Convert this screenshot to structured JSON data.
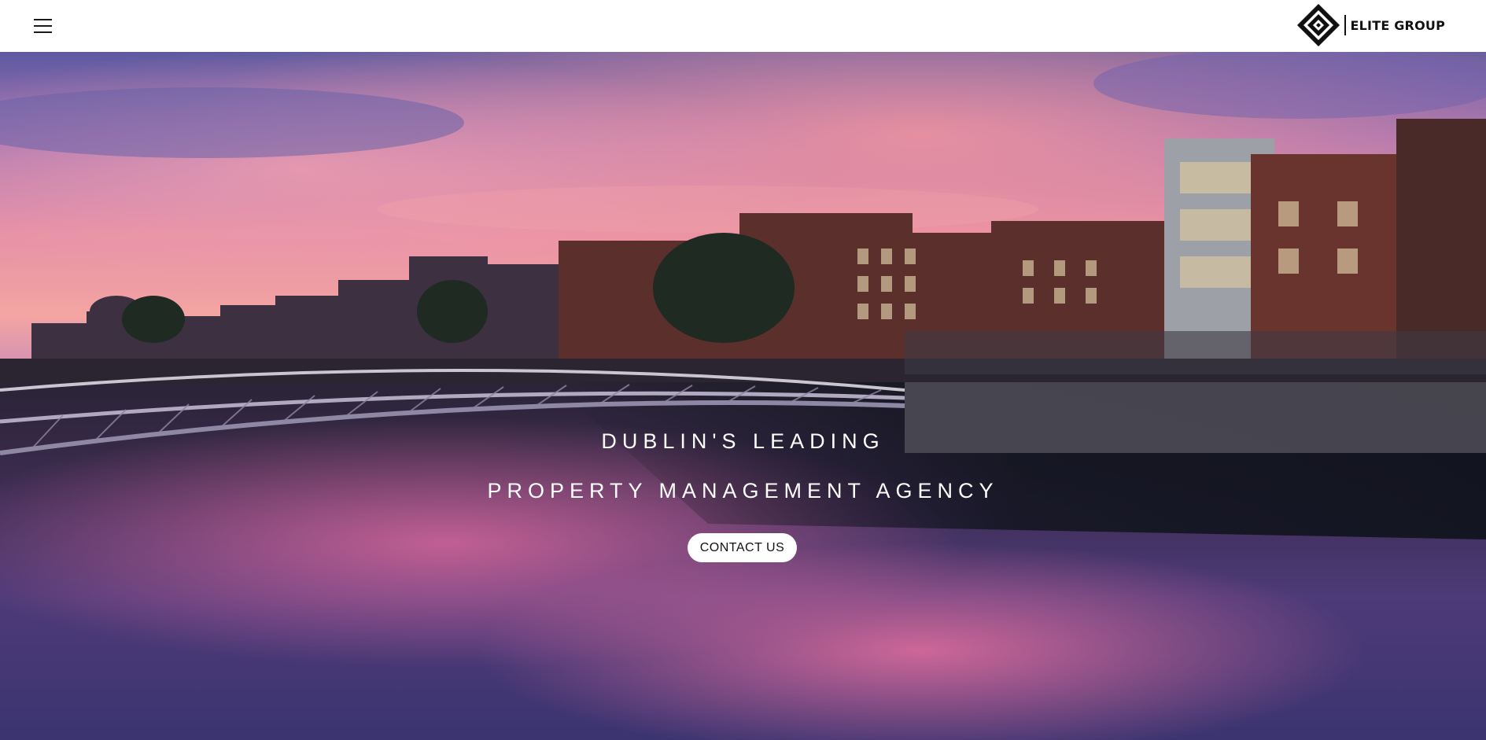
{
  "header": {
    "menu_icon": "hamburger-menu-icon",
    "brand": {
      "logo_icon": "diamond-logo-icon",
      "name": "ELITE GROUP"
    }
  },
  "hero": {
    "headline_line1": "DUBLIN'S LEADING",
    "headline_line2": "PROPERTY MANAGEMENT AGENCY",
    "cta_label": "CONTACT US"
  },
  "colors": {
    "header_bg": "#ffffff",
    "text_dark": "#111111",
    "hero_text": "#ffffff",
    "sky_pink": "#e88aa0",
    "sky_purple": "#6c5aa8",
    "water_dark": "#1c2530"
  }
}
